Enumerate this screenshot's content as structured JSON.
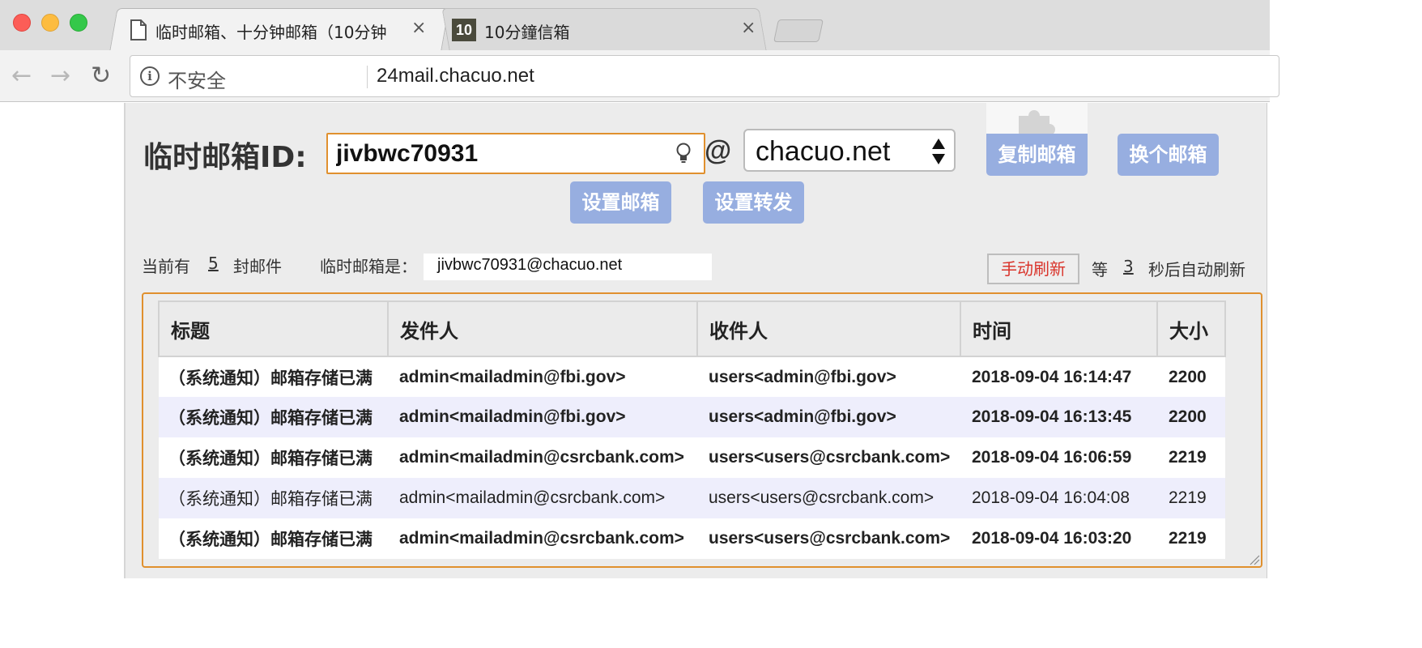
{
  "browser": {
    "tabs": [
      {
        "title": "临时邮箱、十分钟邮箱（10分钟",
        "favicon": "page-icon",
        "active": true
      },
      {
        "title": "10分鐘信箱",
        "favicon": "ten-badge-icon",
        "favicon_text": "10",
        "active": false
      }
    ],
    "close_glyph": "×",
    "nav": {
      "back": "←",
      "forward": "→",
      "reload": "↻"
    },
    "security_label": "不安全",
    "info_glyph": "i",
    "url": "24mail.chacuo.net"
  },
  "form": {
    "id_label": "临时邮箱ID:",
    "mailbox_id": "jivbwc70931",
    "at": "@",
    "domain": "chacuo.net",
    "copy_label": "复制邮箱",
    "change_label": "换个邮箱",
    "set_label": "设置邮箱",
    "forward_label": "设置转发"
  },
  "status": {
    "prefix": "当前有",
    "count": "5",
    "suffix": "封邮件",
    "address_label": "临时邮箱是：",
    "address": "jivbwc70931@chacuo.net",
    "refresh_label": "手动刷新",
    "wait_prefix": "等",
    "seconds": "3",
    "wait_suffix": "秒后自动刷新"
  },
  "table": {
    "headers": [
      "标题",
      "发件人",
      "收件人",
      "时间",
      "大小"
    ],
    "rows": [
      {
        "subject": "（系统通知）邮箱存储已满",
        "from": "admin<mailadmin@fbi.gov>",
        "to": "users<admin@fbi.gov>",
        "time": "2018-09-04 16:14:47",
        "size": "2200"
      },
      {
        "subject": "（系统通知）邮箱存储已满",
        "from": "admin<mailadmin@fbi.gov>",
        "to": "users<admin@fbi.gov>",
        "time": "2018-09-04 16:13:45",
        "size": "2200"
      },
      {
        "subject": "（系统通知）邮箱存储已满",
        "from": "admin<mailadmin@csrcbank.com>",
        "to": "users<users@csrcbank.com>",
        "time": "2018-09-04 16:06:59",
        "size": "2219"
      },
      {
        "subject": "（系统通知）邮箱存储已满",
        "from": "admin<mailadmin@csrcbank.com>",
        "to": "users<users@csrcbank.com>",
        "time": "2018-09-04 16:04:08",
        "size": "2219"
      },
      {
        "subject": "（系统通知）邮箱存储已满",
        "from": "admin<mailadmin@csrcbank.com>",
        "to": "users<users@csrcbank.com>",
        "time": "2018-09-04 16:03:20",
        "size": "2219"
      }
    ]
  },
  "colors": {
    "button": "#97aee0",
    "input_border": "#e0902e",
    "refresh_text": "#d9332a",
    "alt_row": "#eeeefc"
  }
}
